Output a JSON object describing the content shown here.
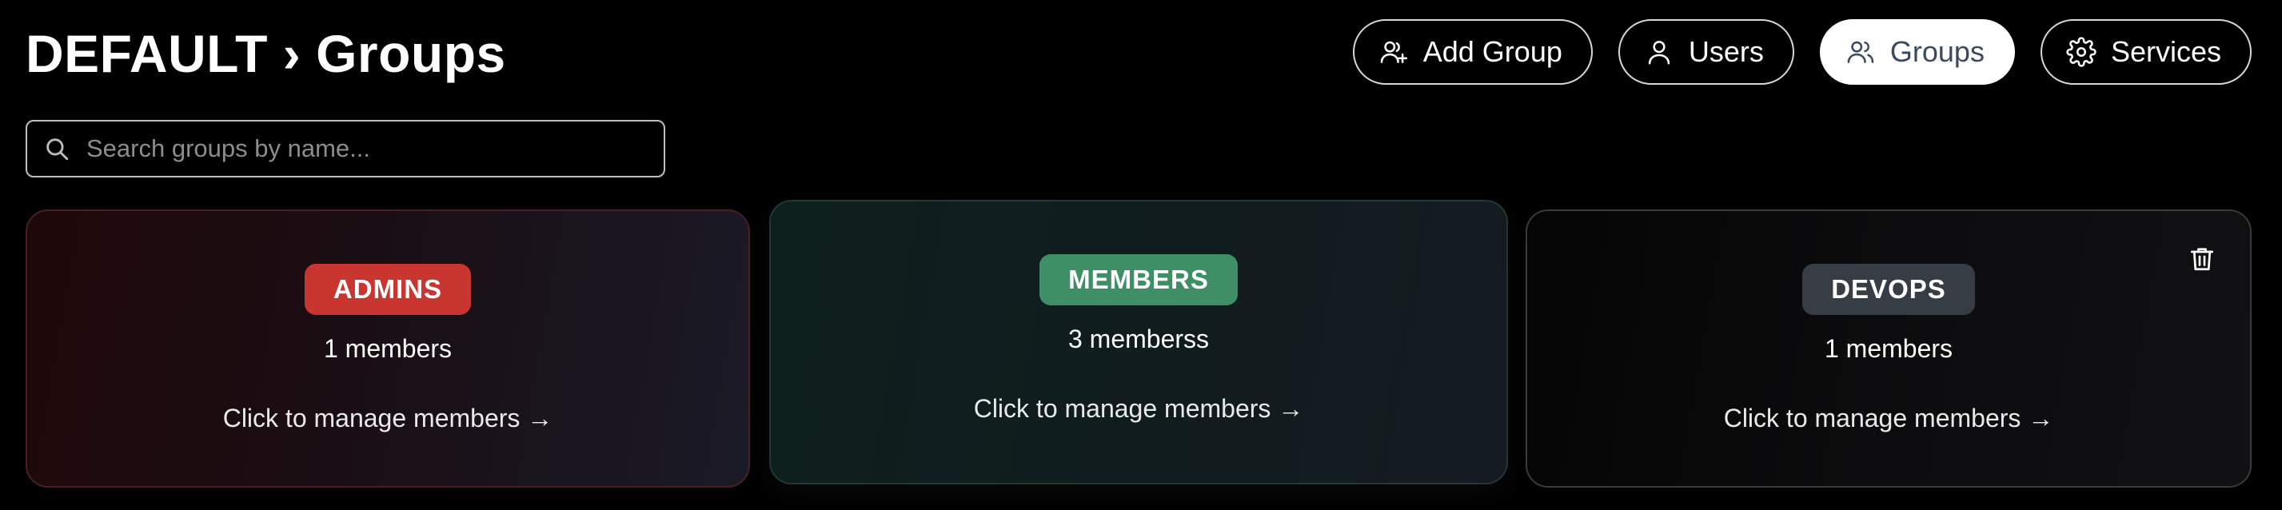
{
  "header": {
    "breadcrumb_root": "DEFAULT",
    "separator": "›",
    "breadcrumb_current": "Groups"
  },
  "nav": {
    "add_group": "Add Group",
    "users": "Users",
    "groups": "Groups",
    "services": "Services",
    "active": "groups"
  },
  "search": {
    "placeholder": "Search groups by name...",
    "value": ""
  },
  "groups": [
    {
      "name": "ADMINS",
      "count_text": "1 members",
      "action_text": "Click to manage members →",
      "badge_color": "#c9352f",
      "deletable": false
    },
    {
      "name": "MEMBERS",
      "count_text": "3 memberss",
      "action_text": "Click to manage members →",
      "badge_color": "#3f8f66",
      "deletable": false
    },
    {
      "name": "DEVOPS",
      "count_text": "1 members",
      "action_text": "Click to manage members →",
      "badge_color": "#373d44",
      "deletable": true
    }
  ],
  "icons": {
    "add_group": "user-plus-icon",
    "users": "user-icon",
    "groups": "users-icon",
    "services": "gear-icon",
    "search": "search-icon",
    "delete": "trash-icon"
  }
}
